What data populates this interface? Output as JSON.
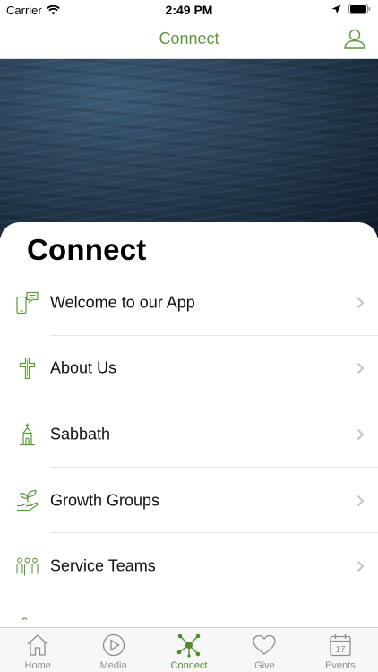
{
  "status_bar": {
    "carrier": "Carrier",
    "time": "2:49 PM"
  },
  "nav": {
    "title": "Connect",
    "profile_icon": "person-outline-icon"
  },
  "page": {
    "heading": "Connect"
  },
  "colors": {
    "accent": "#5a9a3a",
    "tab_active": "#4f8c2e",
    "tab_inactive": "#8e8e8e"
  },
  "list": [
    {
      "label": "Welcome to our App",
      "icon": "phone-chat-icon"
    },
    {
      "label": "About Us",
      "icon": "cross-icon"
    },
    {
      "label": "Sabbath",
      "icon": "chapel-icon"
    },
    {
      "label": "Growth Groups",
      "icon": "hand-plant-icon"
    },
    {
      "label": "Service Teams",
      "icon": "people-group-icon"
    },
    {
      "label": "",
      "icon": "partial-icon"
    }
  ],
  "tabs": [
    {
      "label": "Home",
      "icon": "home-icon",
      "active": false
    },
    {
      "label": "Media",
      "icon": "play-icon",
      "active": false
    },
    {
      "label": "Connect",
      "icon": "network-icon",
      "active": true
    },
    {
      "label": "Give",
      "icon": "heart-icon",
      "active": false
    },
    {
      "label": "Events",
      "icon": "calendar-icon",
      "active": false,
      "calendar_day": "17"
    }
  ]
}
